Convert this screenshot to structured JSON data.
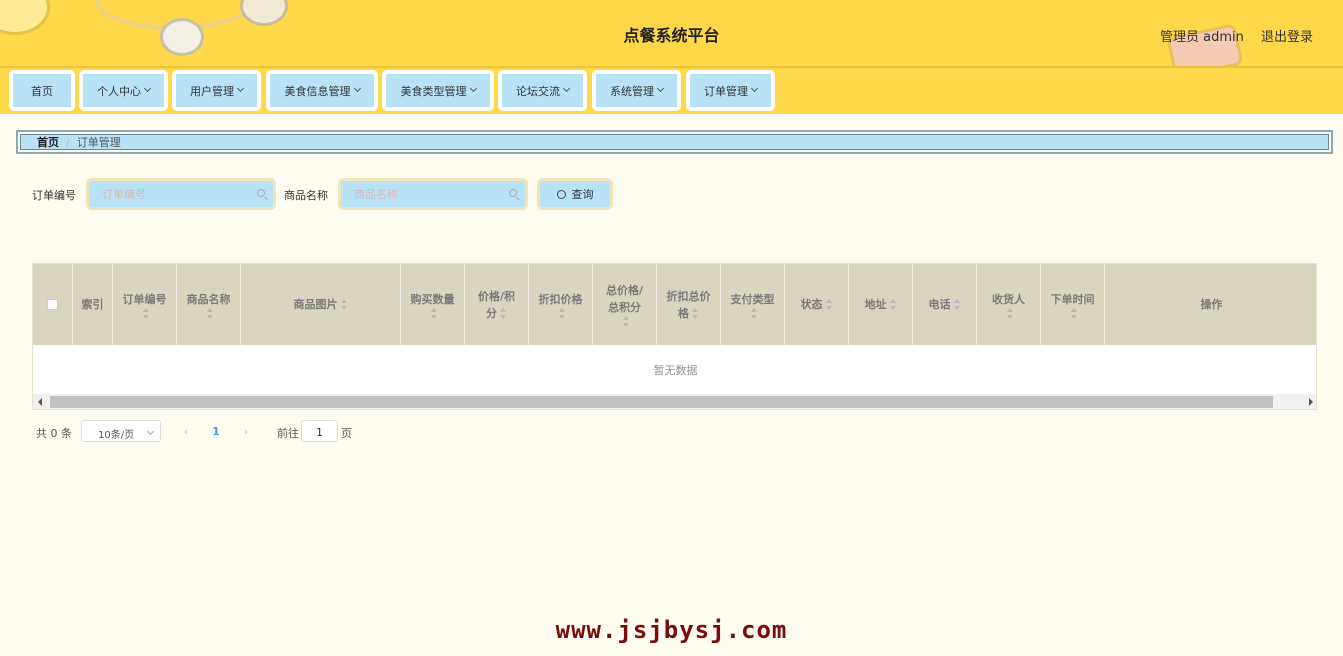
{
  "header": {
    "title": "点餐系统平台",
    "user_label": "管理员 admin",
    "logout_label": "退出登录"
  },
  "nav": {
    "items": [
      {
        "label": "首页",
        "has_menu": false
      },
      {
        "label": "个人中心",
        "has_menu": true
      },
      {
        "label": "用户管理",
        "has_menu": true
      },
      {
        "label": "美食信息管理",
        "has_menu": true
      },
      {
        "label": "美食类型管理",
        "has_menu": true
      },
      {
        "label": "论坛交流",
        "has_menu": true
      },
      {
        "label": "系统管理",
        "has_menu": true
      },
      {
        "label": "订单管理",
        "has_menu": true
      }
    ]
  },
  "breadcrumb": {
    "home": "首页",
    "separator": "/",
    "current": "订单管理"
  },
  "search": {
    "order_no_label": "订单编号",
    "order_no_placeholder": "订单编号",
    "product_name_label": "商品名称",
    "product_name_placeholder": "商品名称",
    "query_label": "查询"
  },
  "table": {
    "columns": [
      {
        "line1": "索引",
        "line2": ""
      },
      {
        "line1": "订单编号",
        "line2": ""
      },
      {
        "line1": "商品名称",
        "line2": ""
      },
      {
        "line1": "商品图片",
        "line2": ""
      },
      {
        "line1": "购买数量",
        "line2": ""
      },
      {
        "line1": "价格/积",
        "line2": "分"
      },
      {
        "line1": "折扣价格",
        "line2": ""
      },
      {
        "line1": "总价格/",
        "line2": "总积分"
      },
      {
        "line1": "折扣总价",
        "line2": "格"
      },
      {
        "line1": "支付类型",
        "line2": ""
      },
      {
        "line1": "状态",
        "line2": ""
      },
      {
        "line1": "地址",
        "line2": ""
      },
      {
        "line1": "电话",
        "line2": ""
      },
      {
        "line1": "收货人",
        "line2": ""
      },
      {
        "line1": "下单时间",
        "line2": ""
      },
      {
        "line1": "操作",
        "line2": ""
      }
    ],
    "empty_text": "暂无数据"
  },
  "pagination": {
    "total_text": "共 0 条",
    "page_size": "10条/页",
    "prev_icon": "‹",
    "current_page": "1",
    "next_icon": "›",
    "goto_label": "前往",
    "goto_value": "1",
    "goto_unit": "页"
  },
  "watermark": "www.jsjbysj.com"
}
